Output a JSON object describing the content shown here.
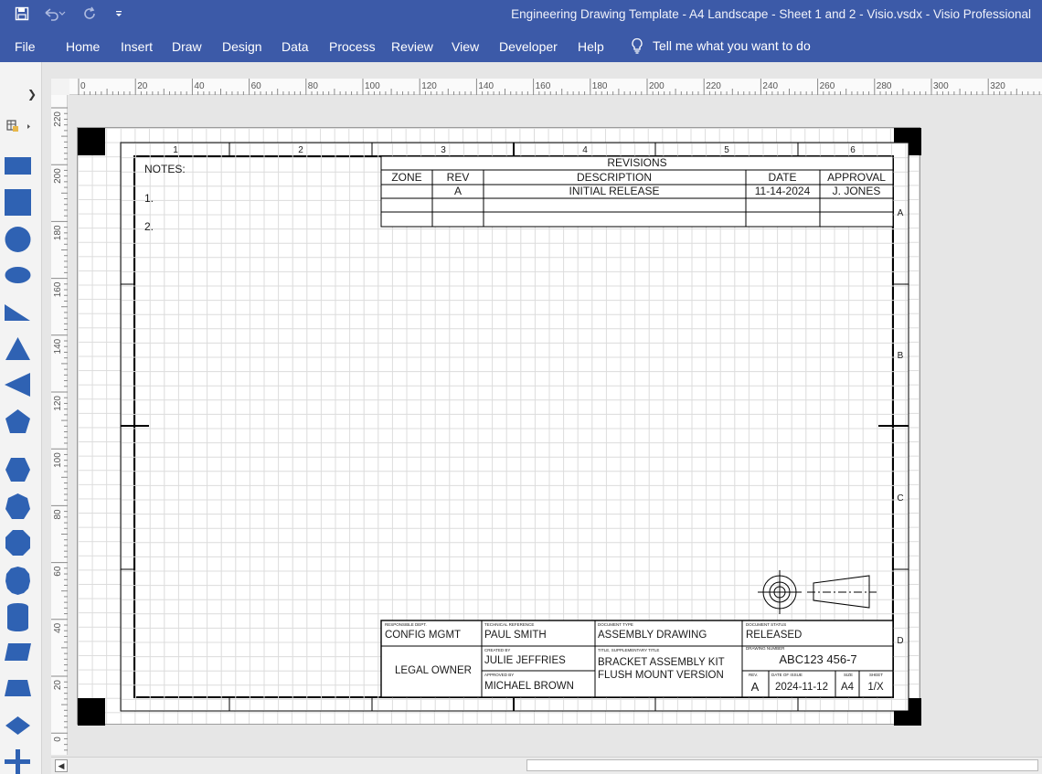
{
  "window": {
    "title": "Engineering Drawing Template - A4 Landscape - Sheet 1 and 2 - Visio.vsdx  -  Visio Professional"
  },
  "quick_access": {
    "save_icon": "save-icon",
    "undo_icon": "undo-icon",
    "redo_icon": "redo-icon",
    "customize_icon": "customize-icon"
  },
  "menu": {
    "items": [
      "File",
      "Home",
      "Insert",
      "Draw",
      "Design",
      "Data",
      "Process",
      "Review",
      "View",
      "Developer",
      "Help"
    ],
    "tell_me": "Tell me what you want to do"
  },
  "ruler": {
    "horizontal_labels": [
      "0",
      "20",
      "40",
      "60",
      "80",
      "100",
      "120",
      "140",
      "160",
      "180",
      "200",
      "220",
      "240",
      "260",
      "280",
      "300",
      "320"
    ],
    "vertical_labels": [
      "220",
      "200",
      "180",
      "160",
      "140",
      "120",
      "100",
      "80",
      "60",
      "40",
      "20",
      "0"
    ]
  },
  "shapes": [
    "rectangle",
    "square",
    "circle",
    "ellipse",
    "right-triangle",
    "triangle",
    "left-triangle",
    "pentagon",
    "hexagon",
    "heptagon",
    "octagon",
    "decagon",
    "cylinder",
    "parallelogram",
    "trapezoid",
    "diamond",
    "cross"
  ],
  "drawing": {
    "zone_columns": [
      "1",
      "2",
      "3",
      "4",
      "5",
      "6"
    ],
    "zone_rows": [
      "A",
      "B",
      "C",
      "D"
    ],
    "notes": {
      "heading": "NOTES:",
      "items": [
        "1.",
        "2."
      ]
    },
    "revisions": {
      "title": "REVISIONS",
      "headers": [
        "ZONE",
        "REV",
        "DESCRIPTION",
        "DATE",
        "APPROVAL"
      ],
      "rows": [
        [
          "",
          "A",
          "INITIAL RELEASE",
          "11-14-2024",
          "J. JONES"
        ],
        [
          "",
          "",
          "",
          "",
          ""
        ],
        [
          "",
          "",
          "",
          "",
          ""
        ]
      ]
    },
    "title_block": {
      "responsible_dept_label": "RESPONSIBLE DEPT.",
      "responsible_dept": "CONFIG MGMT",
      "technical_reference_label": "TECHNICAL REFERENCE",
      "technical_reference": "PAUL SMITH",
      "document_type_label": "DOCUMENT TYPE",
      "document_type": "ASSEMBLY DRAWING",
      "document_status_label": "DOCUMENT STATUS",
      "document_status": "RELEASED",
      "legal_owner": "LEGAL OWNER",
      "created_by_label": "CREATED BY",
      "created_by": "JULIE JEFFRIES",
      "approved_by_label": "APPROVED BY",
      "approved_by": "MICHAEL BROWN",
      "title_label": "TITLE, SUPPLEMENTARY TITLE",
      "title_line1": "BRACKET ASSEMBLY KIT",
      "title_line2": "FLUSH MOUNT VERSION",
      "drawing_number_label": "DRAWING NUMBER",
      "drawing_number": "ABC123 456-7",
      "rev_label": "REV.",
      "rev": "A",
      "date_of_issue_label": "DATE OF ISSUE",
      "date_of_issue": "2024-11-12",
      "size_label": "SIZE",
      "size": "A4",
      "sheet_label": "SHEET",
      "sheet": "1/X"
    }
  },
  "colors": {
    "ribbon": "#3c5aa8",
    "shape_fill": "#2f62b3"
  }
}
